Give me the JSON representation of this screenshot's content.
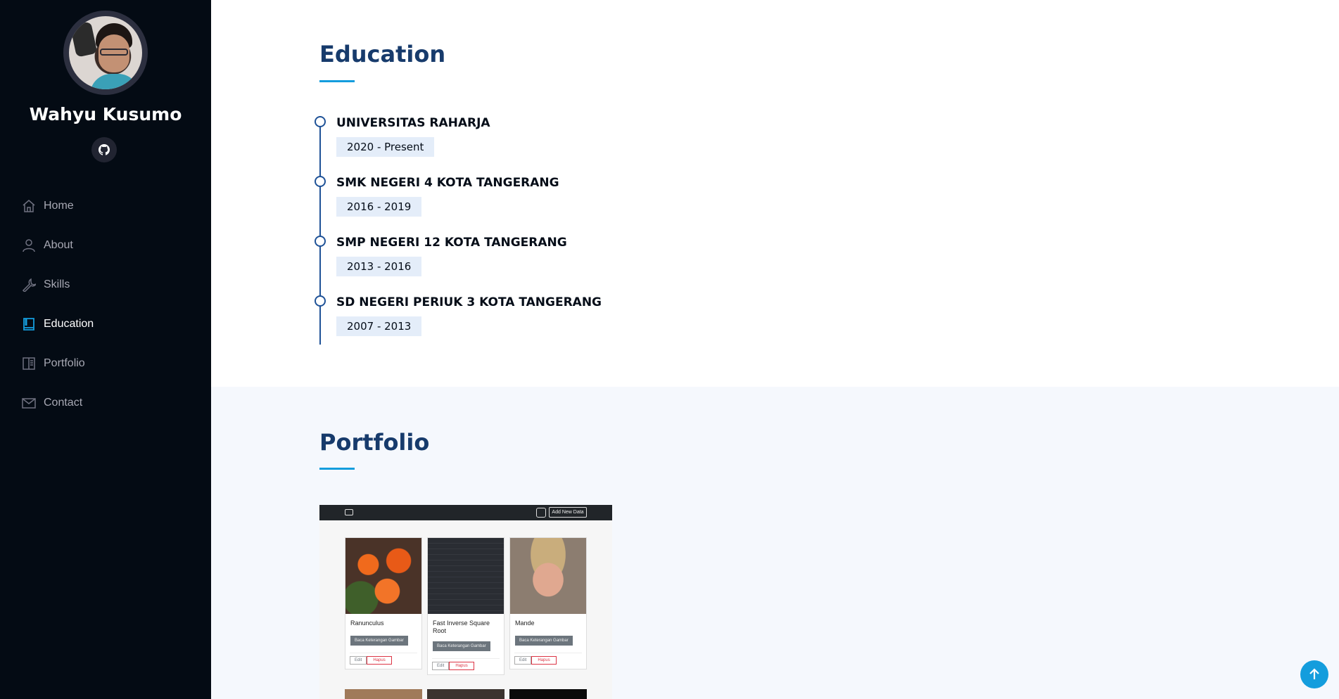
{
  "profile": {
    "name": "Wahyu Kusumo"
  },
  "nav": {
    "items": [
      {
        "label": "Home",
        "icon": "home-icon"
      },
      {
        "label": "About",
        "icon": "person-icon"
      },
      {
        "label": "Skills",
        "icon": "wrench-icon"
      },
      {
        "label": "Education",
        "icon": "book-icon",
        "active": true
      },
      {
        "label": "Portfolio",
        "icon": "book-half-icon"
      },
      {
        "label": "Contact",
        "icon": "envelope-icon"
      }
    ]
  },
  "education": {
    "title": "Education",
    "items": [
      {
        "school": "UNIVERSITAS RAHARJA",
        "date": "2020 - Present"
      },
      {
        "school": "SMK NEGERI 4 KOTA TANGERANG",
        "date": "2016 - 2019"
      },
      {
        "school": "SMP NEGERI 12 KOTA TANGERANG",
        "date": "2013 - 2016"
      },
      {
        "school": "SD NEGERI PERIUK 3 KOTA TANGERANG",
        "date": "2007 - 2013"
      }
    ]
  },
  "portfolio": {
    "title": "Portfolio",
    "preview": {
      "add_button": "Add New Data",
      "cards": [
        {
          "title": "Ranunculus",
          "button": "Baca Keterangan Gambar",
          "edit": "Edit",
          "delete": "Hapus"
        },
        {
          "title": "Fast Inverse Square Root",
          "button": "Baca Keterangan Gambar",
          "edit": "Edit",
          "delete": "Hapus"
        },
        {
          "title": "Mande",
          "button": "Baca Keterangan Gambar",
          "edit": "Edit",
          "delete": "Hapus"
        }
      ]
    }
  },
  "colors": {
    "sidebar_bg": "#040b14",
    "accent": "#149ddd",
    "heading": "#173b6c",
    "date_badge": "#e4edf9"
  }
}
